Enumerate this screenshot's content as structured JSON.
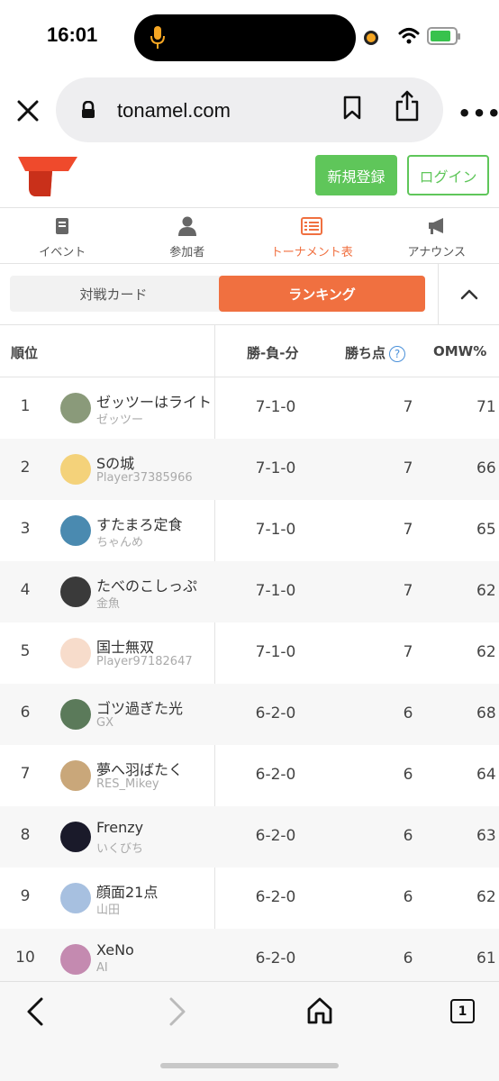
{
  "status_bar": {
    "time": "16:01"
  },
  "browser": {
    "url": "tonamel.com",
    "tabs_count": "1"
  },
  "header": {
    "signup_label": "新規登録",
    "login_label": "ログイン"
  },
  "nav_tabs": [
    {
      "label": "イベント",
      "icon": "document-icon"
    },
    {
      "label": "参加者",
      "icon": "person-icon"
    },
    {
      "label": "トーナメント表",
      "icon": "bracket-icon",
      "active": true
    },
    {
      "label": "アナウンス",
      "icon": "megaphone-icon"
    }
  ],
  "sub_tabs": {
    "match_cards": "対戦カード",
    "ranking": "ランキング",
    "active": "ランキング"
  },
  "table": {
    "headers": {
      "rank": "順位",
      "record": "勝-負-分",
      "points": "勝ち点",
      "help": "?",
      "omw": "OMW%"
    },
    "rows": [
      {
        "rank": "1",
        "name": "ゼッツーはライト",
        "user": "ゼッツー",
        "record": "7-1-0",
        "points": "7",
        "omw": "71"
      },
      {
        "rank": "2",
        "name": "Sの城",
        "user": "Player37385966",
        "record": "7-1-0",
        "points": "7",
        "omw": "66"
      },
      {
        "rank": "3",
        "name": "すたまろ定食",
        "user": "ちゃんめ",
        "record": "7-1-0",
        "points": "7",
        "omw": "65"
      },
      {
        "rank": "4",
        "name": "たべのこしっぷ",
        "user": "金魚",
        "record": "7-1-0",
        "points": "7",
        "omw": "62"
      },
      {
        "rank": "5",
        "name": "国士無双",
        "user": "Player97182647",
        "record": "7-1-0",
        "points": "7",
        "omw": "62"
      },
      {
        "rank": "6",
        "name": "ゴツ過ぎた光",
        "user": "GX",
        "record": "6-2-0",
        "points": "6",
        "omw": "68"
      },
      {
        "rank": "7",
        "name": "夢へ羽ばたく",
        "user": "RES_Mikey",
        "record": "6-2-0",
        "points": "6",
        "omw": "64"
      },
      {
        "rank": "8",
        "name": "Frenzy",
        "user": "いくびち",
        "record": "6-2-0",
        "points": "6",
        "omw": "63"
      },
      {
        "rank": "9",
        "name": "顔面21点",
        "user": "山田",
        "record": "6-2-0",
        "points": "6",
        "omw": "62"
      },
      {
        "rank": "10",
        "name": "XeNo",
        "user": "AI",
        "record": "6-2-0",
        "points": "6",
        "omw": "61"
      }
    ]
  },
  "colors": {
    "accent": "#f07040",
    "green": "#5fc65a",
    "logo": "#ef4a2c"
  }
}
